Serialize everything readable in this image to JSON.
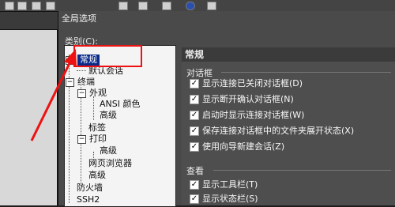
{
  "dialog": {
    "title": "全局选项",
    "category_label": "类别(C):"
  },
  "tree": {
    "items": [
      {
        "label": "常规",
        "toggle": "−"
      },
      {
        "label": "默认会话",
        "toggle": ""
      },
      {
        "label": "终端",
        "toggle": "−"
      },
      {
        "label": "外观",
        "toggle": "−"
      },
      {
        "label": "ANSI 颜色",
        "toggle": ""
      },
      {
        "label": "高级",
        "toggle": ""
      },
      {
        "label": "标签",
        "toggle": ""
      },
      {
        "label": "打印",
        "toggle": "−"
      },
      {
        "label": "高级",
        "toggle": ""
      },
      {
        "label": "网页浏览器",
        "toggle": ""
      },
      {
        "label": "高级",
        "toggle": ""
      },
      {
        "label": "防火墙",
        "toggle": ""
      },
      {
        "label": "SSH2",
        "toggle": ""
      }
    ]
  },
  "panel": {
    "header": "常规",
    "dialogs_group": {
      "title": "对话框",
      "items": [
        {
          "label": "显示连接已关闭对话框(D)",
          "checked": true
        },
        {
          "label": "显示断开确认对话框(N)",
          "checked": true
        },
        {
          "label": "启动时显示连接对话框(W)",
          "checked": true
        },
        {
          "label": "保存连接对话框中的文件夹展开状态(X)",
          "checked": true
        },
        {
          "label": "使用向导新建会话(Z)",
          "checked": true
        }
      ]
    },
    "view_group": {
      "title": "查看",
      "items": [
        {
          "label": "显示工具栏(T)",
          "checked": true
        },
        {
          "label": "显示状态栏(S)",
          "checked": true
        }
      ]
    }
  },
  "colors": {
    "annotation": "#e11111",
    "selection": "#0a2a8a"
  }
}
